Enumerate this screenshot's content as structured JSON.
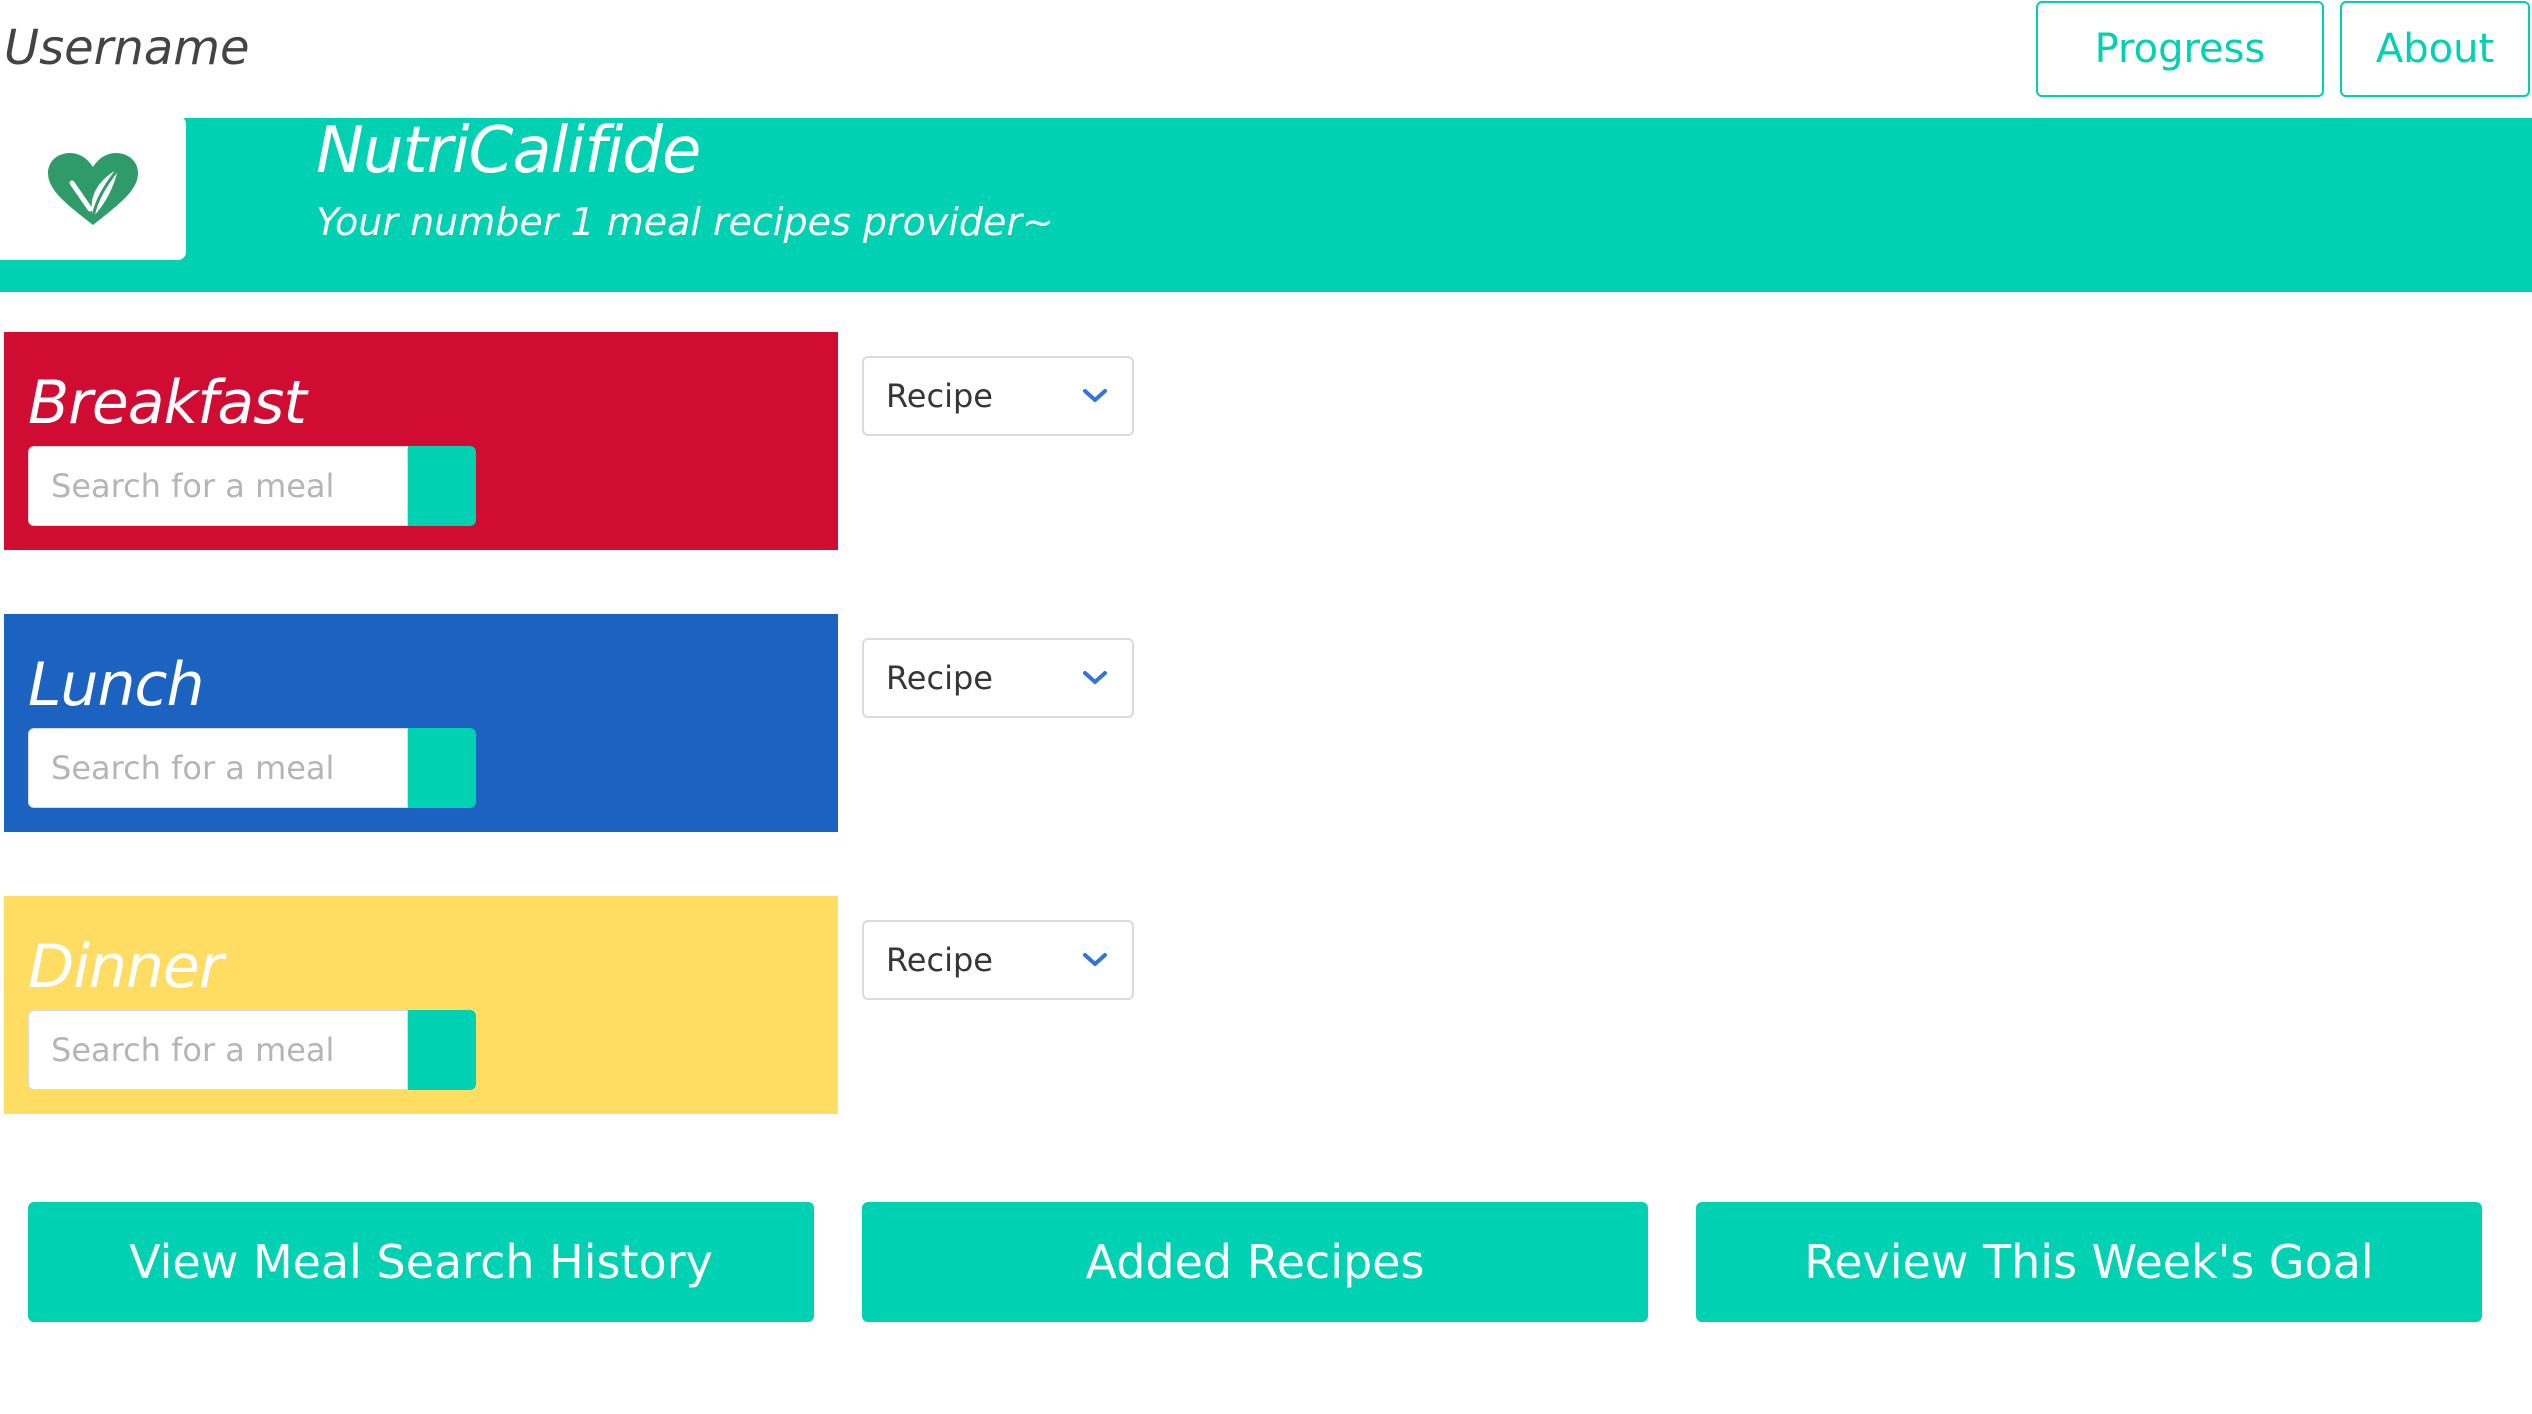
{
  "header": {
    "username": "Username",
    "nav": {
      "progress_label": "Progress",
      "about_label": "About"
    }
  },
  "hero": {
    "logo_icon": "heart-leaf-fork-icon",
    "title": "NutriCalifide",
    "subtitle": "Your number 1 meal recipes provider~"
  },
  "meals": [
    {
      "title": "Breakfast",
      "color": "#d00c32",
      "search_placeholder": "Search for a meal",
      "select_value": "Recipe"
    },
    {
      "title": "Lunch",
      "color": "#1c62c0",
      "search_placeholder": "Search for a meal",
      "select_value": "Recipe"
    },
    {
      "title": "Dinner",
      "color": "#ffdd62",
      "search_placeholder": "Search for a meal",
      "select_value": "Recipe"
    }
  ],
  "actions": {
    "history_label": "View Meal Search History",
    "added_label": "Added Recipes",
    "goal_label": "Review This Week's Goal"
  },
  "colors": {
    "accent": "#00d1b2",
    "logo_green": "#2f9b6a"
  }
}
